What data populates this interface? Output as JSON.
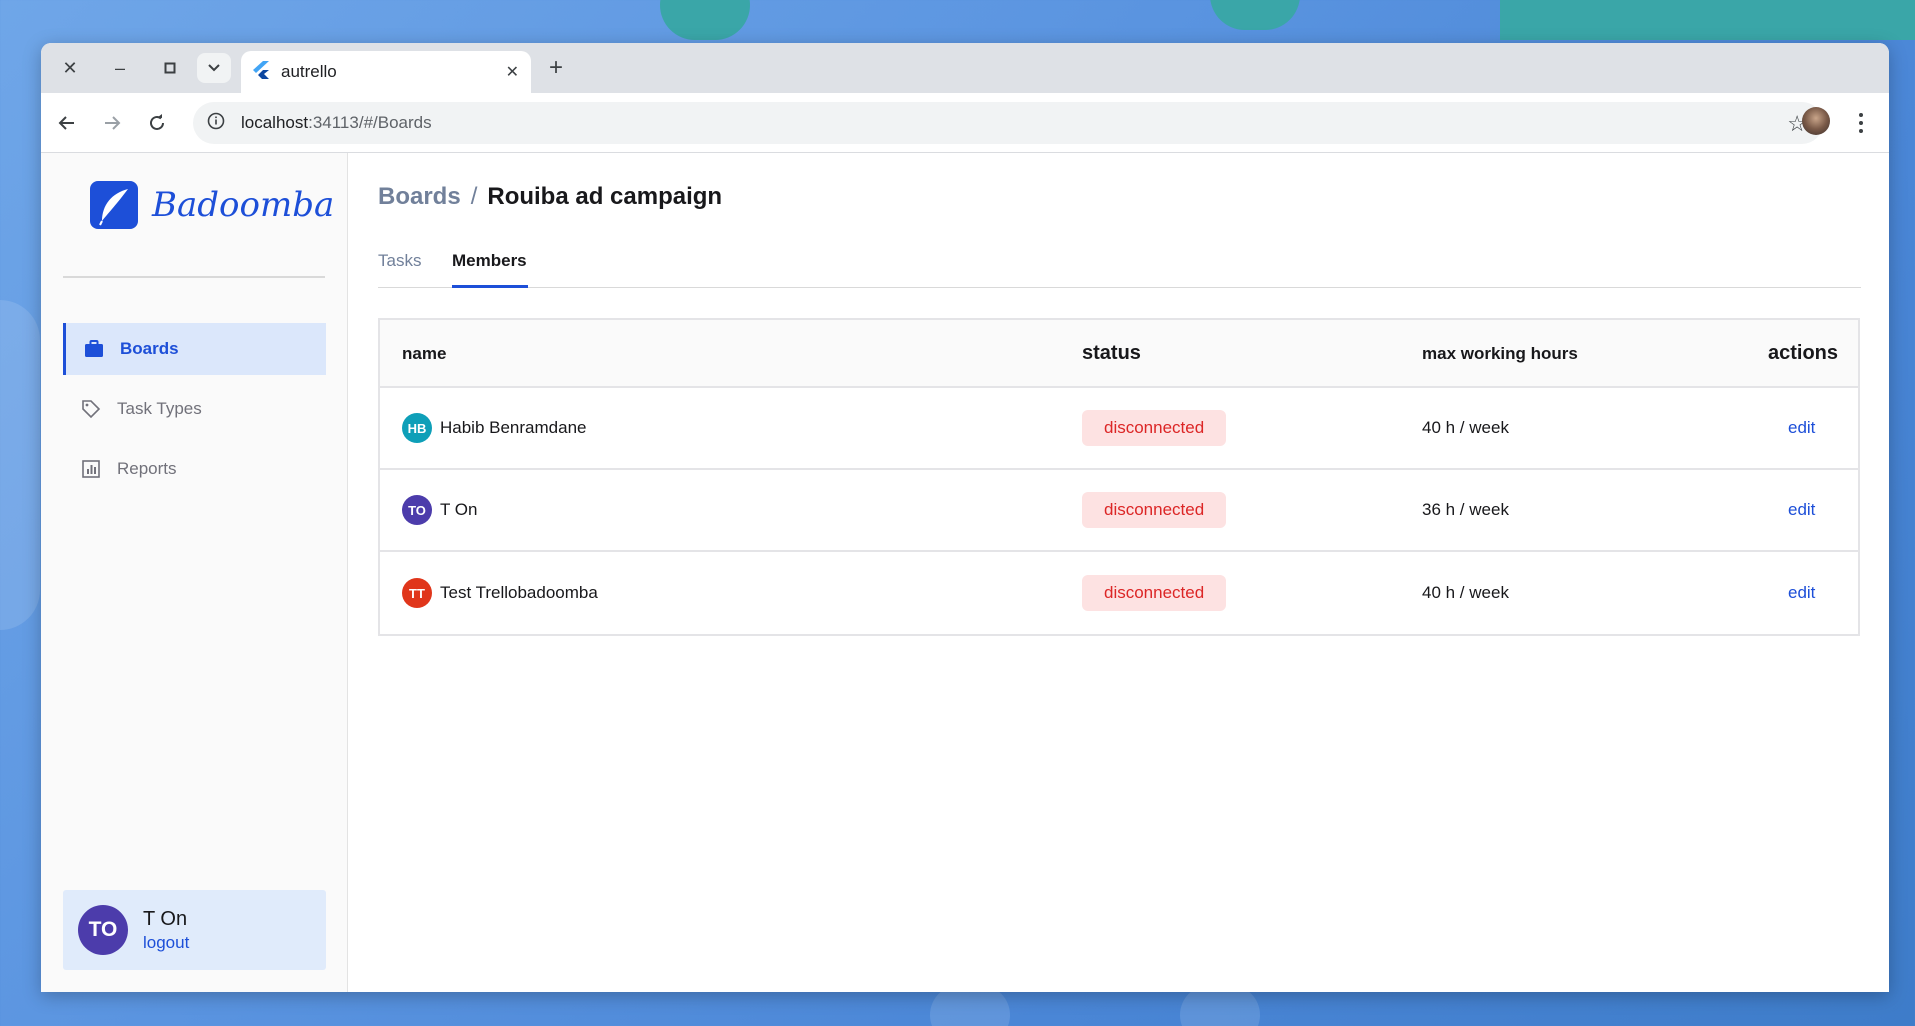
{
  "browser": {
    "tab_title": "autrello",
    "url_host": "localhost",
    "url_rest": ":34113/#/Boards"
  },
  "app": {
    "brand": "Badoomba",
    "nav": [
      {
        "label": "Boards",
        "icon": "briefcase-icon",
        "active": true
      },
      {
        "label": "Task Types",
        "icon": "tag-icon",
        "active": false
      },
      {
        "label": "Reports",
        "icon": "chart-icon",
        "active": false
      }
    ],
    "user": {
      "initials": "TO",
      "name": "T On",
      "logout": "logout"
    }
  },
  "page": {
    "breadcrumb_root": "Boards",
    "breadcrumb_sep": "/",
    "breadcrumb_current": "Rouiba ad campaign",
    "tabs": [
      "Tasks",
      "Members"
    ],
    "active_tab": "Members"
  },
  "table": {
    "headers": {
      "name": "name",
      "status": "status",
      "hours": "max working hours",
      "actions": "actions"
    },
    "rows": [
      {
        "initials": "HB",
        "avatar_color": "#0e9fb8",
        "name": "Habib Benramdane",
        "status": "disconnected",
        "hours": "40 h / week",
        "action": "edit"
      },
      {
        "initials": "TO",
        "avatar_color": "#4c3cab",
        "name": "T On",
        "status": "disconnected",
        "hours": "36 h / week",
        "action": "edit"
      },
      {
        "initials": "TT",
        "avatar_color": "#e0361b",
        "name": "Test Trellobadoomba",
        "status": "disconnected",
        "hours": "40 h / week",
        "action": "edit"
      }
    ]
  },
  "colors": {
    "accent": "#1d4fd8",
    "status_bg": "#fde2e2",
    "status_text": "#dc2626"
  }
}
